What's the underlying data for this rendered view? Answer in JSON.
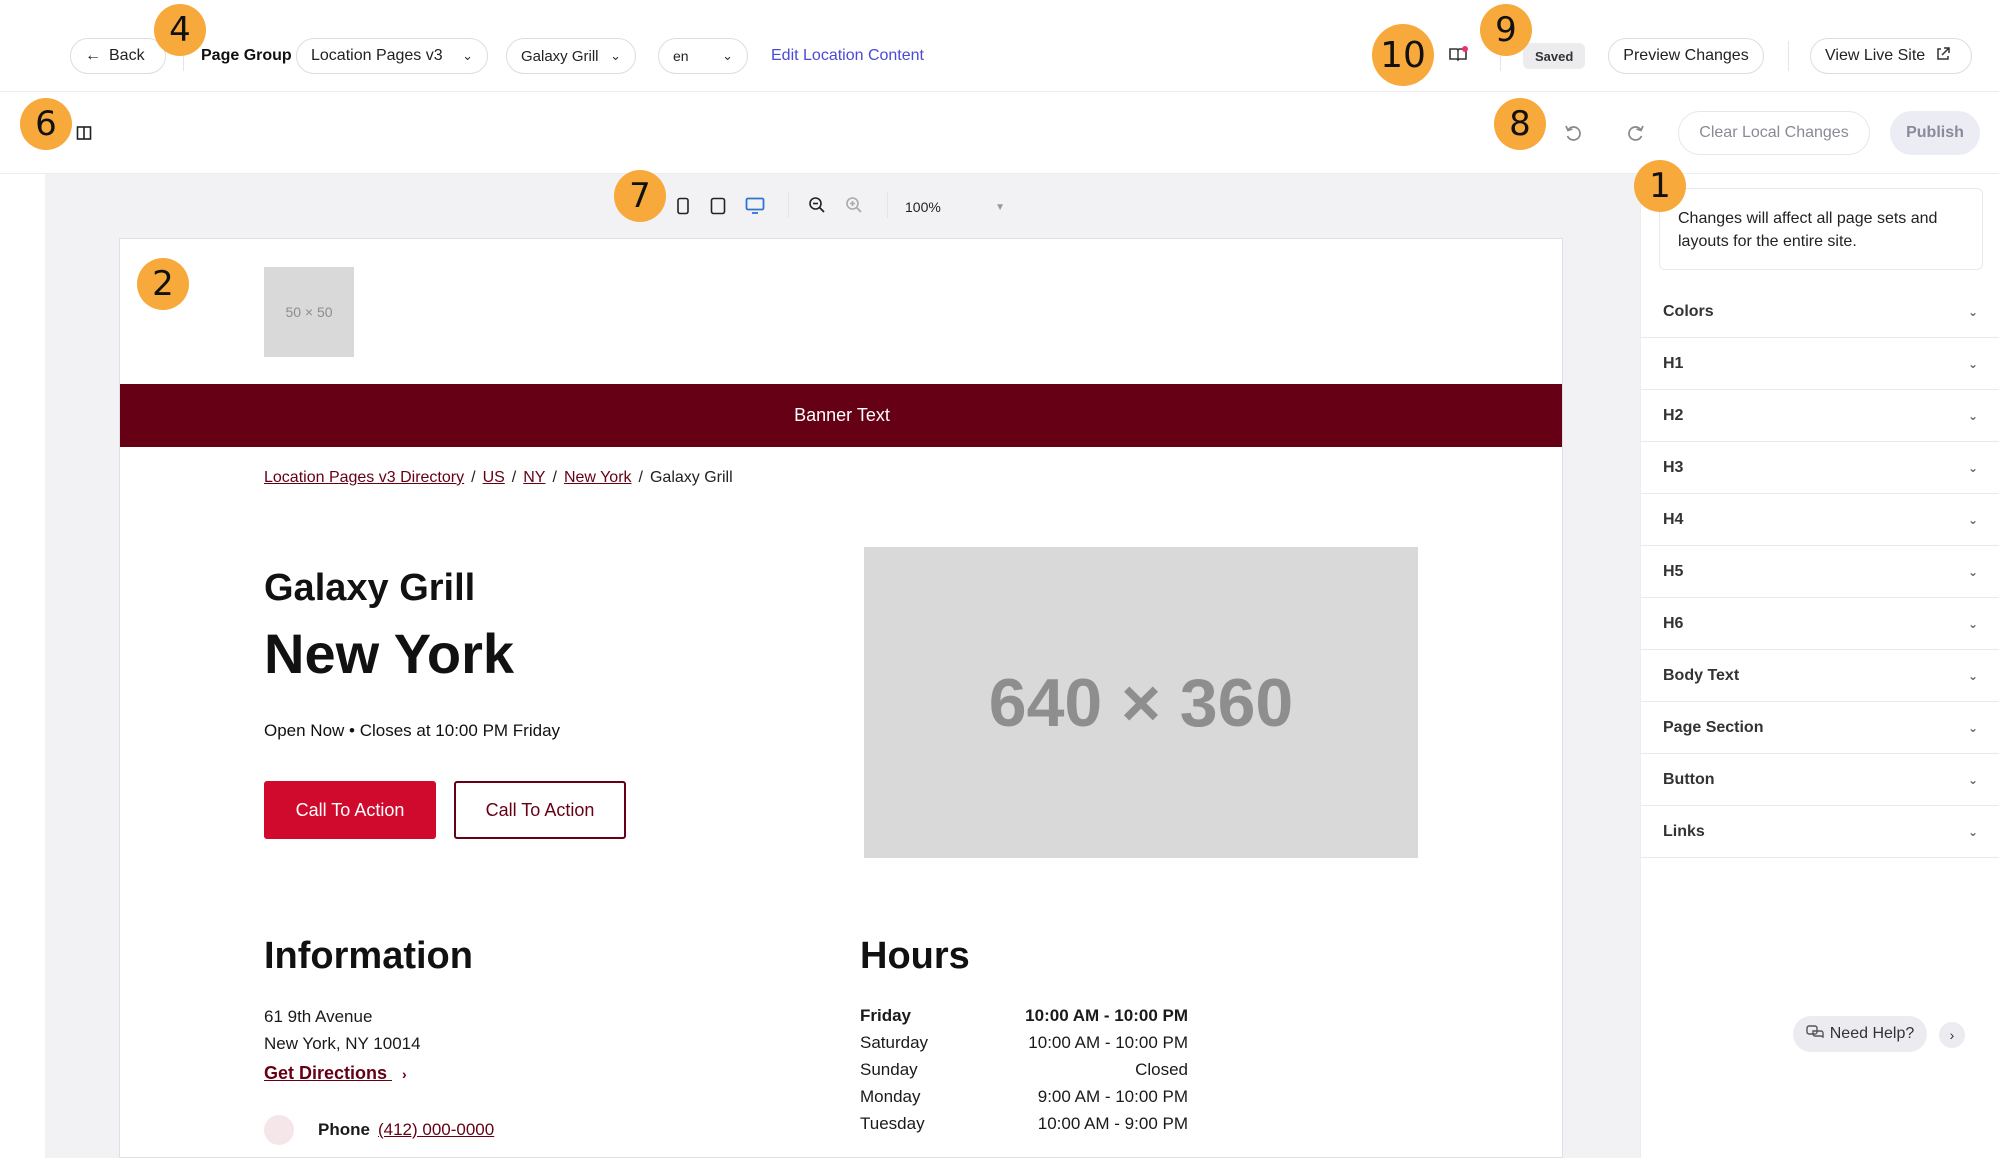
{
  "topbar": {
    "back_label": "Back",
    "page_group_label": "Page Group",
    "page_group_value": "Location Pages v3",
    "location_value": "Galaxy Grill",
    "locale_value": "en",
    "edit_content_link": "Edit Location Content",
    "saved_badge": "Saved",
    "preview_changes_label": "Preview Changes",
    "view_live_site_label": "View Live Site"
  },
  "toolbar": {
    "clear_changes_label": "Clear Local Changes",
    "publish_label": "Publish"
  },
  "canvas_toolbar": {
    "zoom_value": "100%"
  },
  "preview": {
    "logo_placeholder": "50 × 50",
    "banner_text": "Banner Text",
    "breadcrumbs": [
      "Location Pages v3 Directory",
      "US",
      "NY",
      "New York",
      "Galaxy Grill"
    ],
    "breadcrumb_separator": "/",
    "business_name": "Galaxy Grill",
    "city": "New York",
    "open_status": "Open Now • Closes at 10:00 PM Friday",
    "cta_primary": "Call To Action",
    "cta_secondary": "Call To Action",
    "hero_image_placeholder": "640 × 360",
    "info_heading": "Information",
    "address_line1": "61 9th Avenue",
    "address_line2": "New York, NY 10014",
    "directions_link": "Get Directions",
    "phone_label": "Phone",
    "phone_value": "(412) 000-0000",
    "hours_heading": "Hours",
    "hours": [
      {
        "day": "Friday",
        "time": "10:00 AM - 10:00 PM",
        "current": true
      },
      {
        "day": "Saturday",
        "time": "10:00 AM - 10:00 PM",
        "current": false
      },
      {
        "day": "Sunday",
        "time": "Closed",
        "current": false
      },
      {
        "day": "Monday",
        "time": "9:00 AM - 10:00 PM",
        "current": false
      },
      {
        "day": "Tuesday",
        "time": "10:00 AM - 9:00 PM",
        "current": false
      }
    ]
  },
  "right_panel": {
    "notice": "Changes will affect all page sets and layouts for the entire site.",
    "sections": [
      "Colors",
      "H1",
      "H2",
      "H3",
      "H4",
      "H5",
      "H6",
      "Body Text",
      "Page Section",
      "Button",
      "Links"
    ],
    "need_help_label": "Need Help?"
  },
  "markers": [
    "1",
    "2",
    "4",
    "6",
    "7",
    "8",
    "9",
    "10"
  ],
  "colors": {
    "brand_dark": "#650015",
    "brand_red": "#cf0a2c",
    "link_blue": "#4a4ad6",
    "marker_orange": "#f7a93b"
  }
}
